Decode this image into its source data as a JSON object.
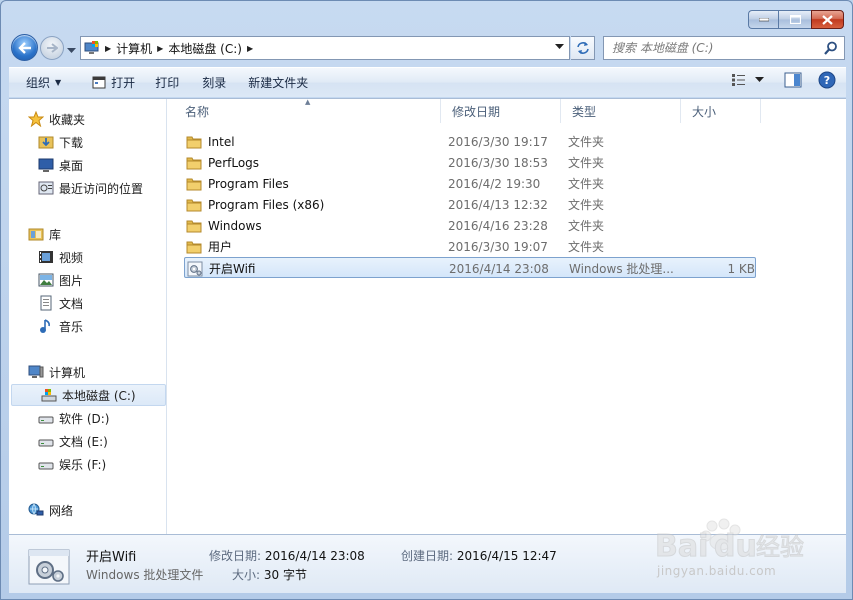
{
  "colors": {
    "window_frame": "#b4cbe8",
    "selection_border": "#7da2ce",
    "selection_fill": "#d4e6fa",
    "folder_yellow": "#e8c25a",
    "close_red": "#c0391e"
  },
  "address": {
    "crumbs": [
      "计算机",
      "本地磁盘 (C:)"
    ]
  },
  "search": {
    "placeholder": "搜索 本地磁盘 (C:)"
  },
  "toolbar": {
    "organize": "组织",
    "open": "打开",
    "print": "打印",
    "burn": "刻录",
    "new_folder": "新建文件夹"
  },
  "nav": {
    "favorites": "收藏夹",
    "downloads": "下载",
    "desktop": "桌面",
    "recent": "最近访问的位置",
    "libraries": "库",
    "videos": "视频",
    "pictures": "图片",
    "documents": "文档",
    "music": "音乐",
    "computer": "计算机",
    "drive_c": "本地磁盘 (C:)",
    "drive_d": "软件 (D:)",
    "drive_e": "文档 (E:)",
    "drive_f": "娱乐 (F:)",
    "network": "网络"
  },
  "columns": {
    "name": "名称",
    "date": "修改日期",
    "type": "类型",
    "size": "大小"
  },
  "files": [
    {
      "name": "Intel",
      "date": "2016/3/30 19:17",
      "type": "文件夹",
      "size": "",
      "icon": "folder-icon"
    },
    {
      "name": "PerfLogs",
      "date": "2016/3/30 18:53",
      "type": "文件夹",
      "size": "",
      "icon": "folder-icon"
    },
    {
      "name": "Program Files",
      "date": "2016/4/2 19:30",
      "type": "文件夹",
      "size": "",
      "icon": "folder-icon"
    },
    {
      "name": "Program Files (x86)",
      "date": "2016/4/13 12:32",
      "type": "文件夹",
      "size": "",
      "icon": "folder-icon"
    },
    {
      "name": "Windows",
      "date": "2016/4/16 23:28",
      "type": "文件夹",
      "size": "",
      "icon": "folder-icon"
    },
    {
      "name": "用户",
      "date": "2016/3/30 19:07",
      "type": "文件夹",
      "size": "",
      "icon": "folder-icon"
    },
    {
      "name": "开启Wifi",
      "date": "2016/4/14 23:08",
      "type": "Windows 批处理...",
      "size": "1 KB",
      "icon": "batch-file-icon",
      "selected": true
    }
  ],
  "details": {
    "name": "开启Wifi",
    "type": "Windows 批处理文件",
    "modified_label": "修改日期:",
    "modified_value": "2016/4/14 23:08",
    "size_label": "大小:",
    "size_value": "30 字节",
    "created_label": "创建日期:",
    "created_value": "2016/4/15 12:47"
  },
  "watermark": {
    "logo": "Baidu经验",
    "url": "jingyan.baidu.com"
  }
}
